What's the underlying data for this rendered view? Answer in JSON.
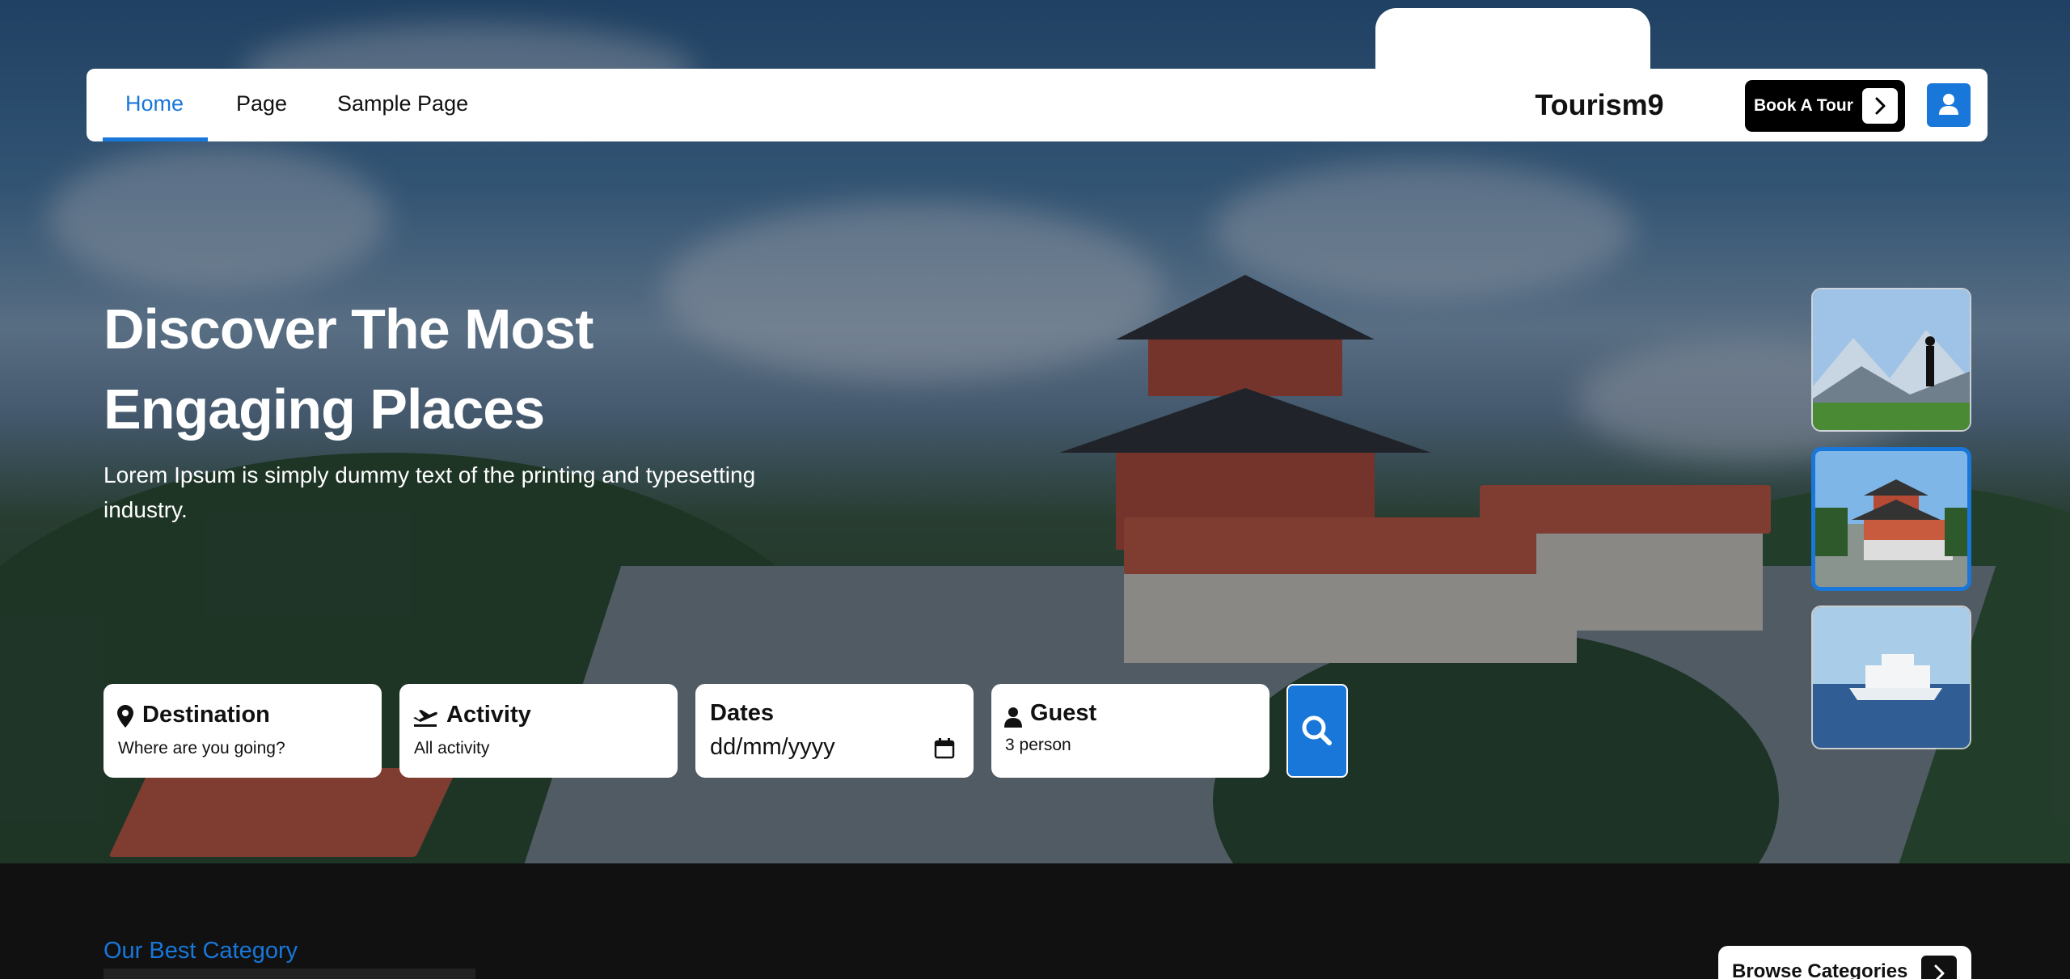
{
  "nav": {
    "links": [
      {
        "label": "Home",
        "active": true
      },
      {
        "label": "Page",
        "active": false
      },
      {
        "label": "Sample Page",
        "active": false
      }
    ],
    "brand": "Tourism9",
    "book_label": "Book A Tour",
    "accent": "#1877d9"
  },
  "hero": {
    "title_line1": "Discover The Most",
    "title_line2": "Engaging Places",
    "subtitle": "Lorem Ipsum is simply dummy text of the printing and typesetting industry."
  },
  "thumbnails": [
    {
      "icon": "mountain-hiker-image",
      "selected": false
    },
    {
      "icon": "temple-image",
      "selected": true
    },
    {
      "icon": "cruise-ship-image",
      "selected": false
    }
  ],
  "search": {
    "destination": {
      "title": "Destination",
      "value": "Where are you going?",
      "icon": "map-pin-icon"
    },
    "activity": {
      "title": "Activity",
      "value": "All activity",
      "icon": "plane-icon"
    },
    "dates": {
      "title": "Dates",
      "value": "dd/mm/yyyy",
      "icon": "calendar-icon"
    },
    "guest": {
      "title": "Guest",
      "value": "3 person",
      "icon": "person-icon"
    }
  },
  "section": {
    "tag": "Our Best Category",
    "browse_label": "Browse Categories"
  }
}
